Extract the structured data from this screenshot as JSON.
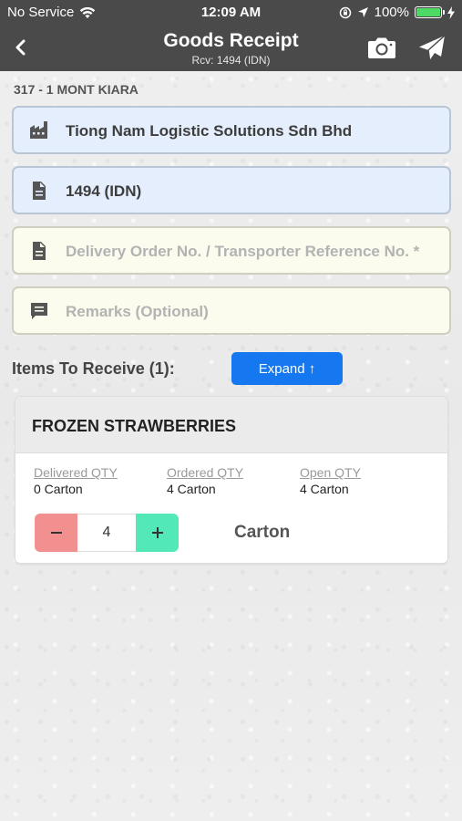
{
  "status_bar": {
    "carrier": "No Service",
    "time": "12:09 AM",
    "battery": "100%"
  },
  "nav": {
    "title": "Goods Receipt",
    "subtitle": "Rcv: 1494 (IDN)"
  },
  "location": "317 - 1 MONT KIARA",
  "fields": {
    "supplier": "Tiong Nam Logistic Solutions Sdn Bhd",
    "receipt": "1494 (IDN)",
    "delivery_placeholder": "Delivery Order No. / Transporter Reference No. *",
    "remarks_placeholder": "Remarks (Optional)"
  },
  "items": {
    "label": "Items To Receive (1):",
    "expand_label": "Expand ↑",
    "list": [
      {
        "name": "FROZEN STRAWBERRIES",
        "delivered_label": "Delivered QTY",
        "delivered_value": "0  Carton",
        "ordered_label": "Ordered QTY",
        "ordered_value": "4  Carton",
        "open_label": "Open QTY",
        "open_value": "4  Carton",
        "qty": "4",
        "unit": "Carton"
      }
    ]
  },
  "colors": {
    "nav_bg": "#4a4a4a",
    "field_blue": "#e4eefc",
    "field_cream": "#fbfbee",
    "accent_blue": "#1678f0",
    "minus_red": "#f28f8f",
    "plus_green": "#52e8b7"
  }
}
